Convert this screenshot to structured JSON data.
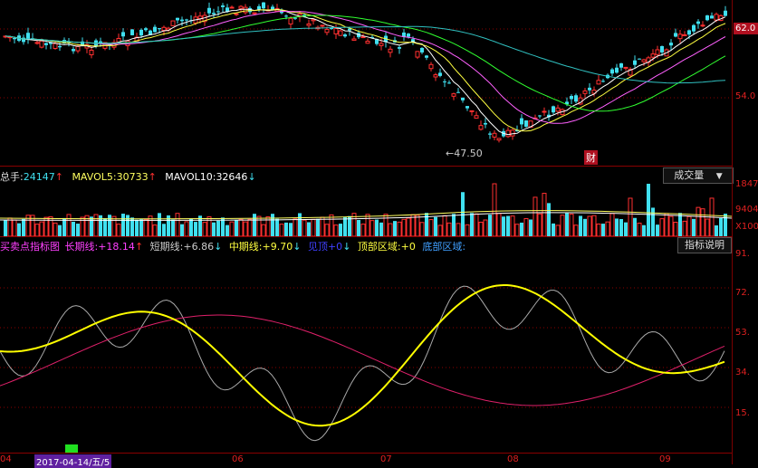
{
  "price_axis": {
    "current_price": "62.0",
    "ticks": [
      "54.0"
    ],
    "low_marker": "47.50",
    "event_marker": "财"
  },
  "volume_panel": {
    "total_label": "总手:",
    "total_value": "24147",
    "mavol5_label": "MAVOL5:",
    "mavol5_value": "30733",
    "mavol10_label": "MAVOL10:",
    "mavol10_value": "32646",
    "dropdown_label": "成交量",
    "ticks": [
      "1847",
      "9404",
      "X100"
    ]
  },
  "indicator_panel": {
    "name": "买卖点指标图",
    "long_label": "长期线:",
    "long_value": "+18.14",
    "short_label": "短期线:",
    "short_value": "+6.86",
    "mid_label": "中期线:",
    "mid_value": "+9.70",
    "top_label": "见顶",
    "top_value": "+0",
    "top_zone_label": "顶部区域:",
    "top_zone_value": "+0",
    "bottom_zone_label": "底部区域:",
    "help_button": "指标说明",
    "ticks": [
      "91.",
      "72.",
      "53.",
      "34.",
      "15."
    ]
  },
  "time_axis": {
    "labels": [
      "04",
      "06",
      "07",
      "08",
      "09"
    ],
    "cursor_date": "2017-04-14/五/5"
  },
  "colors": {
    "background": "#000000",
    "up": "#ff3030",
    "down": "#40e0f0",
    "ma5": "#ffffff",
    "ma10": "#ffff40",
    "ma20": "#ff60ff",
    "ma30": "#30ff30",
    "ma60": "#30c0c0",
    "grid": "#8a0000",
    "long_line": "#ffff00",
    "short_line": "#aaaaaa",
    "mid_line": "#e0206a"
  }
}
